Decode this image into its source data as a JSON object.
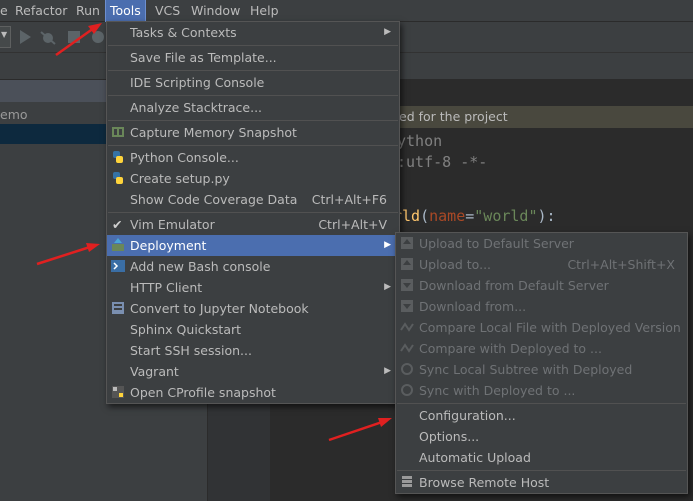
{
  "menubar": {
    "items": [
      {
        "label": "e"
      },
      {
        "label": "Refactor"
      },
      {
        "label": "Run"
      },
      {
        "label": "Tools"
      },
      {
        "label": "VCS"
      },
      {
        "label": "Window"
      },
      {
        "label": "Help"
      }
    ]
  },
  "project_panel": {
    "row_text": "emo"
  },
  "editor": {
    "notice": "ed for the project",
    "line1": "ython",
    "line2": ":utf-8 -*-",
    "line3_fn": "rld",
    "line3_a": "(",
    "line3_param": "name",
    "line3_b": "=",
    "line3_str": "\"world\"",
    "line3_c": "):"
  },
  "tools_menu": {
    "items": [
      {
        "label": "Tasks & Contexts",
        "submenu": true
      },
      {
        "label": "Save File as Template..."
      },
      {
        "label": "IDE Scripting Console"
      },
      {
        "label": "Analyze Stacktrace..."
      },
      {
        "label": "Capture Memory Snapshot"
      },
      {
        "label": "Python Console..."
      },
      {
        "label": "Create setup.py"
      },
      {
        "label": "Show Code Coverage Data",
        "shortcut": "Ctrl+Alt+F6"
      },
      {
        "label": "Vim Emulator",
        "shortcut": "Ctrl+Alt+V"
      },
      {
        "label": "Deployment",
        "submenu": true
      },
      {
        "label": "Add new Bash console"
      },
      {
        "label": "HTTP Client",
        "submenu": true
      },
      {
        "label": "Convert to Jupyter Notebook"
      },
      {
        "label": "Sphinx Quickstart"
      },
      {
        "label": "Start SSH session..."
      },
      {
        "label": "Vagrant",
        "submenu": true
      },
      {
        "label": "Open CProfile snapshot"
      }
    ]
  },
  "deployment_menu": {
    "items": [
      {
        "label": "Upload to Default Server"
      },
      {
        "label": "Upload to...",
        "shortcut": "Ctrl+Alt+Shift+X"
      },
      {
        "label": "Download from Default Server"
      },
      {
        "label": "Download from..."
      },
      {
        "label": "Compare Local File with Deployed Version"
      },
      {
        "label": "Compare with Deployed to ..."
      },
      {
        "label": "Sync Local Subtree with Deployed"
      },
      {
        "label": "Sync with Deployed to ..."
      },
      {
        "label": "Configuration..."
      },
      {
        "label": "Options..."
      },
      {
        "label": "Automatic Upload"
      },
      {
        "label": "Browse Remote Host"
      }
    ]
  },
  "colors": {
    "menu_bg": "#3c3f41",
    "selection": "#4b6eaf",
    "annotation_arrow": "#e02020"
  }
}
